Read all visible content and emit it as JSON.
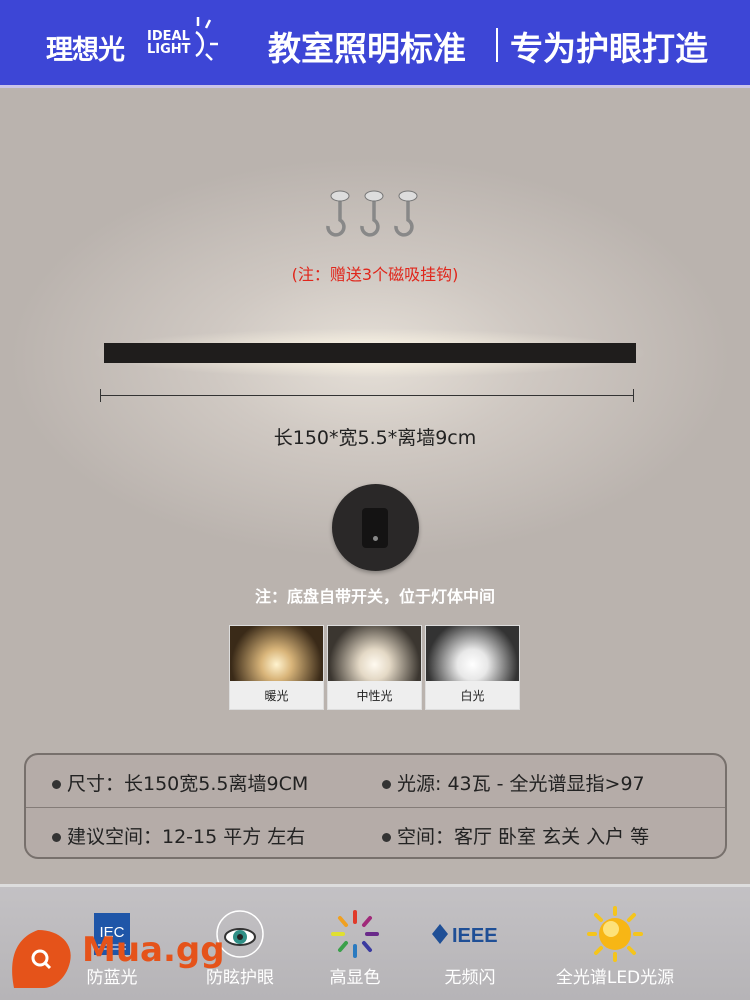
{
  "header": {
    "logo_cn": "理想光",
    "logo_en_1": "IDEAL",
    "logo_en_2": "LIGHT",
    "slogan_left": "教室照明标准",
    "slogan_right": "专为护眼打造"
  },
  "product": {
    "hook_note": "(注：赠送3个磁吸挂钩)",
    "dimensions": "长150*宽5.5*离墙9cm",
    "switch_note": "注：底盘自带开关，位于灯体中间",
    "color_options": [
      {
        "label": "暖光",
        "color": "#f3d7a0"
      },
      {
        "label": "中性光",
        "color": "#f3ece0"
      },
      {
        "label": "白光",
        "color": "#ffffff"
      }
    ]
  },
  "specs": [
    [
      "尺寸：长150宽5.5离墙9CM",
      "光源: 43瓦 - 全光谱显指>97"
    ],
    [
      "建议空间：12-15 平方 左右",
      "空间：客厅 卧室 玄关 入户 等"
    ]
  ],
  "features": [
    {
      "label": "防蓝光",
      "icon": "iec-logo-icon"
    },
    {
      "label": "防眩护眼",
      "icon": "eye-icon"
    },
    {
      "label": "高显色",
      "icon": "color-spectrum-icon"
    },
    {
      "label": "无频闪",
      "icon": "ieee-logo-icon"
    },
    {
      "label": "全光谱LED光源",
      "icon": "sun-icon"
    }
  ],
  "logos": {
    "iec": "IEC",
    "ieee": "IEEE"
  },
  "watermark": "Mua.gg",
  "colors": {
    "header": "#3d46d6",
    "note_red": "#e0261b",
    "watermark": "#e5531a"
  }
}
